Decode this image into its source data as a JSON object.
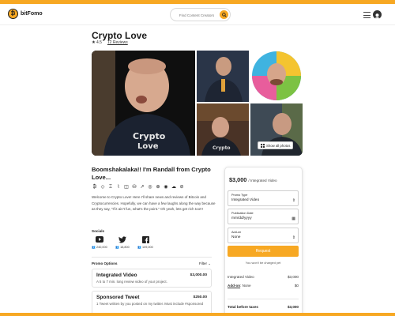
{
  "header": {
    "logo_text": "bitFomo",
    "search_placeholder": "Find Content Creators"
  },
  "creator": {
    "name": "Crypto Love",
    "rating": "4.5",
    "reviews_label": "12 Reviews",
    "headline": "Boomshakalaka!! I'm Randall from Crypto Love...",
    "bio": "Welcome to Crypto Love! Here I'll share news and reviews of Bitcoin and Cryptocurrencies. Hopefully, we can have a few laughs along the way because as they say, \"If it ain't fun, what's the point.\" Oh yeah, lets get rich too!!!"
  },
  "gallery": {
    "show_all_label": "Show all photos",
    "tile_colors": [
      "#0d0d0d",
      "#2a3548",
      "#e85d9c",
      "#4a3326",
      "#3e4a55"
    ]
  },
  "socials": {
    "title": "Socials",
    "items": [
      {
        "icon": "youtube-icon",
        "count": "240,000"
      },
      {
        "icon": "twitter-icon",
        "count": "18,800"
      },
      {
        "icon": "facebook-icon",
        "count": "109,000"
      }
    ]
  },
  "promo": {
    "title": "Promo Options",
    "filter_label": "Filter",
    "options": [
      {
        "name": "Integrated Video",
        "price": "$3,000.00",
        "desc": "A 5 to 7 min. long review video of your project."
      },
      {
        "name": "Sponsored Tweet",
        "price": "$250.00",
        "desc": "1 Tweet written by you posted on my twitter. Must include #sponsored"
      }
    ]
  },
  "booking": {
    "price": "$3,000",
    "price_sub": "/ Integrated Video",
    "promo_type_label": "Promo Type",
    "promo_type_value": "Integrated Video",
    "pub_date_label": "Publication Date",
    "pub_date_value": "mm/dd/yyyy",
    "addon_label": "Add-on",
    "addon_value": "None",
    "request_label": "Request",
    "charge_note": "You won't be charged yet",
    "line_item_1": "Integrated Video",
    "line_item_1_value": "$3,000",
    "line_item_2_label": "Add-on",
    "line_item_2_text": ": None",
    "line_item_2_value": "$0",
    "total_label": "Total before taxes",
    "total_value": "$3,000"
  },
  "colors": {
    "accent": "#f7a823"
  }
}
